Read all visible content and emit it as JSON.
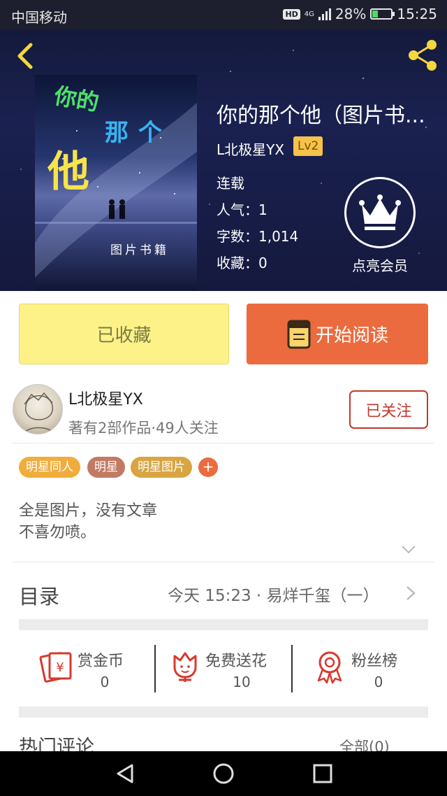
{
  "status_bar": {
    "carrier": "中国移动",
    "hd": "HD",
    "network": "4G",
    "battery": "28%",
    "time": "15:25"
  },
  "book": {
    "title": "你的那个他（图片书...",
    "author": "L北极星YX",
    "level": "Lv2",
    "status": "连载",
    "popularity": "人气：1",
    "word_count": "字数：1,014",
    "favorites": "收藏：0",
    "vip_label": "点亮会员",
    "cover_text": [
      "你的",
      "那个",
      "他",
      "图片书籍"
    ]
  },
  "actions": {
    "favorited": "已收藏",
    "start_reading": "开始阅读"
  },
  "author_card": {
    "name": "L北极星YX",
    "stats": "著有2部作品·49人关注",
    "follow": "已关注"
  },
  "tags": [
    {
      "label": "明星同人",
      "color": "#f0ad3c"
    },
    {
      "label": "明星",
      "color": "#c27a63"
    },
    {
      "label": "明星图片",
      "color": "#d9a542"
    }
  ],
  "tag_add": "+",
  "description": {
    "line1": "全是图片，没有文章",
    "line2": "不喜勿喷。"
  },
  "toc": {
    "label": "目录",
    "latest": "今天 15:23 · 易烊千玺（一）"
  },
  "stats": [
    {
      "name": "赏金币",
      "value": "0",
      "icon": "red-envelope-icon"
    },
    {
      "name": "免费送花",
      "value": "10",
      "icon": "flower-icon"
    },
    {
      "name": "粉丝榜",
      "value": "0",
      "icon": "medal-icon"
    }
  ],
  "comments": {
    "label": "热门评论",
    "all": "全部(0)"
  },
  "colors": {
    "accent": "#eb6b3e",
    "favorite_bg": "#fdf288",
    "icon_red": "#d9382c"
  }
}
